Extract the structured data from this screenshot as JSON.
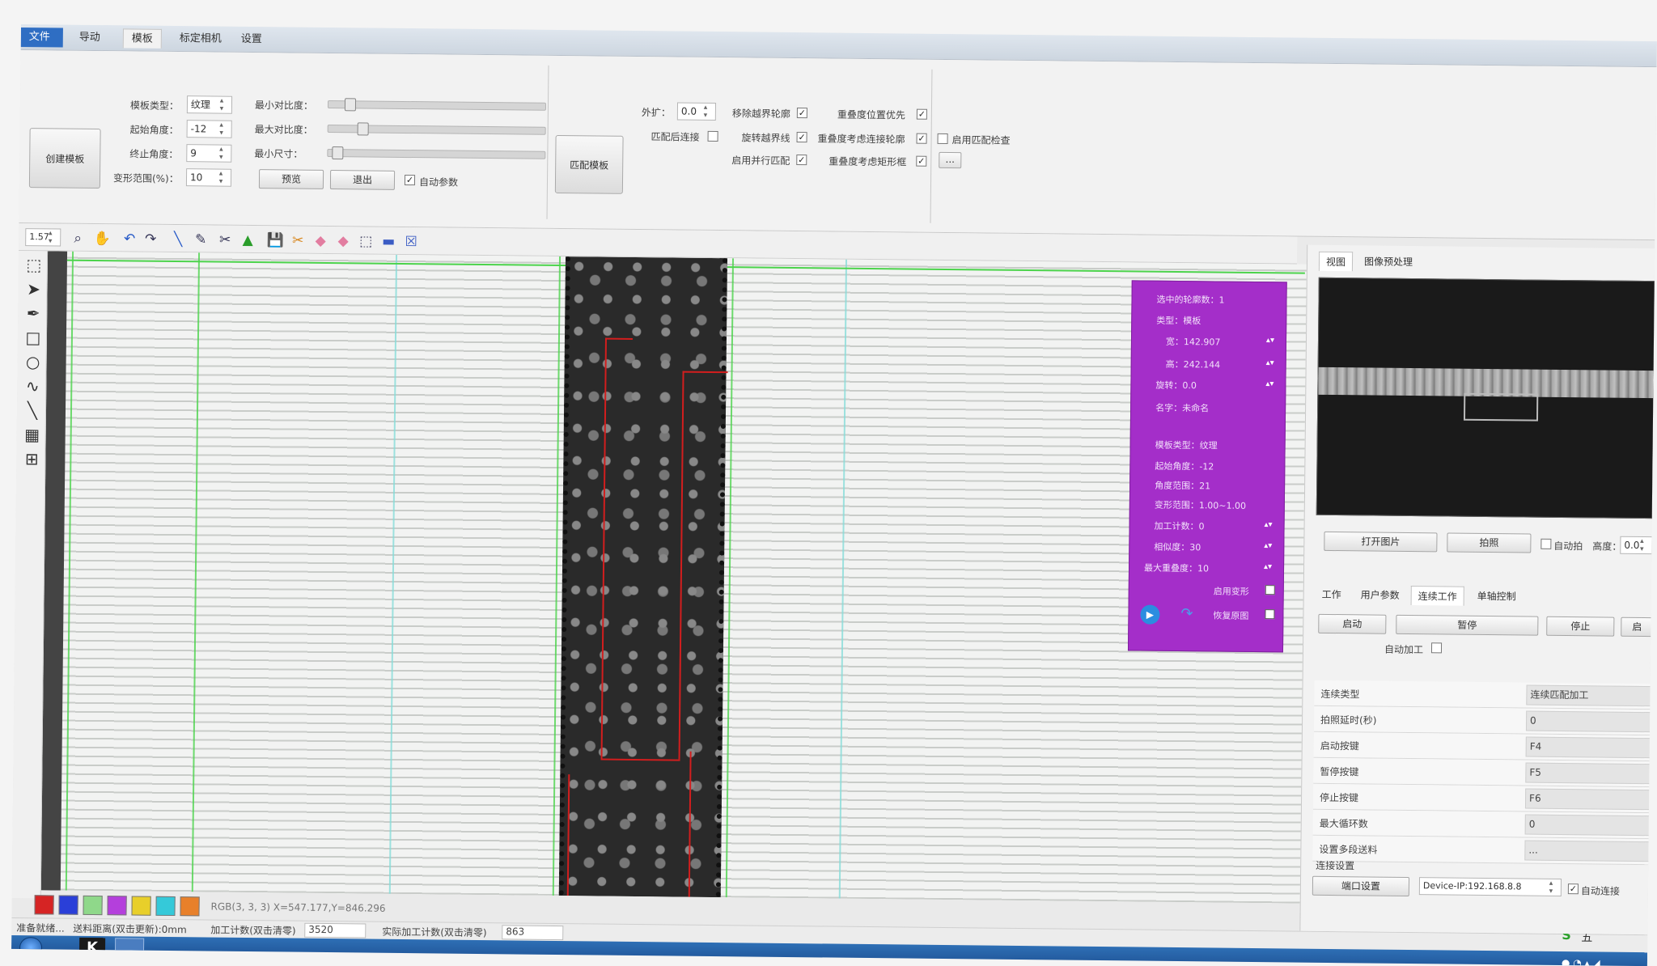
{
  "menu": {
    "file": "文件 ▾",
    "tabs": [
      "导动",
      "模板",
      "标定相机",
      "设置"
    ]
  },
  "ribbon": {
    "create_template": "创建模板",
    "template_type_label": "模板类型：",
    "template_type_value": "纹理",
    "start_angle_label": "起始角度：",
    "start_angle_value": "-12",
    "end_angle_label": "终止角度：",
    "end_angle_value": "9",
    "deform_label": "变形范围(%)：",
    "deform_value": "10",
    "min_contrast_label": "最小对比度：",
    "max_contrast_label": "最大对比度：",
    "min_size_label": "最小尺寸：",
    "min_contrast_pct": 0.08,
    "max_contrast_pct": 0.14,
    "min_size_pct": 0.02,
    "preview": "预览",
    "exit": "退出",
    "auto_param": "自动参数",
    "match_template": "匹配模板",
    "expand_label": "外扩：",
    "expand_value": "0.0",
    "match_connect": "匹配后连接",
    "remove_border_contour": "移除越界轮廓",
    "rotate_border_line": "旋转越界线",
    "enable_parallel_match": "启用并行匹配",
    "overlap_priority": "重叠度位置优先",
    "overlap_connect": "重叠度考虑连接轮廓",
    "overlap_frame": "重叠度考虑矩形框",
    "enable_match_check": "启用匹配检查",
    "ellipsis": "..."
  },
  "toolbar": {
    "zoom": "1.57"
  },
  "purple_panel": {
    "selected_count": "选中的轮廓数：1",
    "type": "类型：模板",
    "width": "宽：142.907",
    "height": "高：242.144",
    "rotation": "旋转：0.0",
    "name": "名字：未命名",
    "tpl_type": "模板类型：纹理",
    "start_angle": "起始角度：-12",
    "angle_range": "角度范围：21",
    "deform_range": "变形范围：1.00~1.00",
    "process_count": "加工计数：0",
    "similarity": "相似度：30",
    "max_overlap": "最大重叠度：10",
    "enable_deform": "启用变形",
    "restore_image": "恢复原图"
  },
  "colors": [
    "#d62424",
    "#2a3fd8",
    "#8fd88a",
    "#b43fdc",
    "#e8cf2a",
    "#35c9d9",
    "#e8802a"
  ],
  "canvas_info": "RGB(3, 3, 3) X=547.177,Y=846.296",
  "status": {
    "ready": "准备就绪...",
    "feed_label": "送料距离(双击更新):0mm",
    "process_label": "加工计数(双击清零)",
    "process_value": "3520",
    "actual_label": "实际加工计数(双击清零)",
    "actual_value": "863"
  },
  "right": {
    "tabs_top": [
      "视图",
      "图像预处理"
    ],
    "open_image": "打开图片",
    "capture": "拍照",
    "auto_capture": "自动拍",
    "height_label": "高度：",
    "height_value": "0.0",
    "tabs_mid": [
      "工作",
      "用户参数",
      "连续工作",
      "单轴控制"
    ],
    "start": "启动",
    "pause": "暂停",
    "stop": "停止",
    "more": "启",
    "auto_process": "自动加工",
    "props": [
      {
        "k": "连续类型",
        "v": "连续匹配加工"
      },
      {
        "k": "拍照延时(秒)",
        "v": "0"
      },
      {
        "k": "启动按键",
        "v": "F4"
      },
      {
        "k": "暂停按键",
        "v": "F5"
      },
      {
        "k": "停止按键",
        "v": "F6"
      },
      {
        "k": "最大循环数",
        "v": "0"
      },
      {
        "k": "设置多段送料",
        "v": "..."
      }
    ],
    "conn_title": "连接设置",
    "port_settings": "端口设置",
    "device": "Device-IP:192.168.8.8",
    "auto_connect": "自动连接"
  },
  "tray": {
    "ime": "五"
  }
}
